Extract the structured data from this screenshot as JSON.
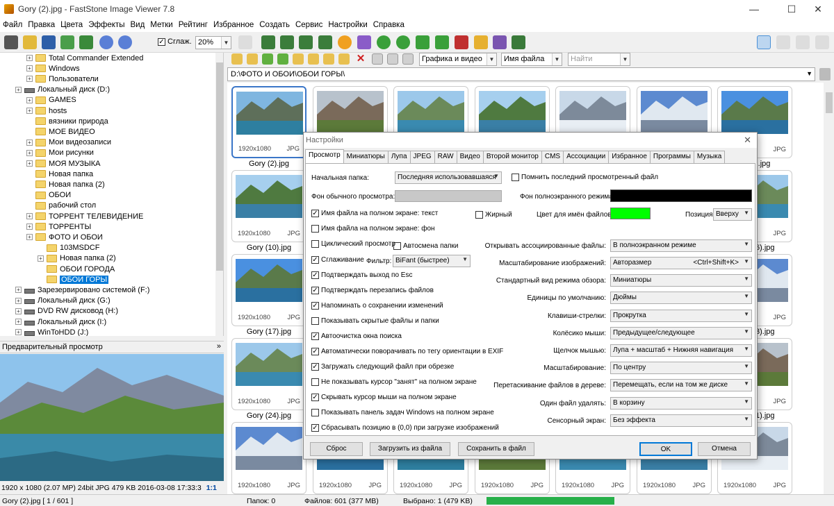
{
  "window": {
    "title": "Gory (2).jpg - FastStone Image Viewer 7.8",
    "min": "—",
    "max": "☐",
    "close": "✕"
  },
  "menu": [
    "Файл",
    "Правка",
    "Цвета",
    "Эффекты",
    "Вид",
    "Метки",
    "Рейтинг",
    "Избранное",
    "Создать",
    "Сервис",
    "Настройки",
    "Справка"
  ],
  "toolbar": {
    "smooth_label": "Сглаж.",
    "zoom": "20%"
  },
  "tree": [
    {
      "label": "Total Commander Extended",
      "level": 2,
      "type": "folder",
      "plus": true
    },
    {
      "label": "Windows",
      "level": 2,
      "type": "folder",
      "plus": true
    },
    {
      "label": "Пользователи",
      "level": 2,
      "type": "folder",
      "plus": true
    },
    {
      "label": "Локальный диск (D:)",
      "level": 1,
      "type": "drive",
      "plus": true
    },
    {
      "label": "GAMES",
      "level": 2,
      "type": "folder",
      "plus": true
    },
    {
      "label": "hosts",
      "level": 2,
      "type": "folder",
      "plus": true
    },
    {
      "label": "вязники природа",
      "level": 2,
      "type": "folder",
      "plus": false
    },
    {
      "label": "МОЕ ВИДЕО",
      "level": 2,
      "type": "folder",
      "plus": false
    },
    {
      "label": "Мои видеозаписи",
      "level": 2,
      "type": "folder",
      "plus": true
    },
    {
      "label": "Мои рисунки",
      "level": 2,
      "type": "folder",
      "plus": true
    },
    {
      "label": "МОЯ МУЗЫКА",
      "level": 2,
      "type": "folder",
      "plus": true
    },
    {
      "label": "Новая папка",
      "level": 2,
      "type": "folder",
      "plus": false
    },
    {
      "label": "Новая папка (2)",
      "level": 2,
      "type": "folder",
      "plus": false
    },
    {
      "label": "ОБОИ",
      "level": 2,
      "type": "folder",
      "plus": false
    },
    {
      "label": "рабочий стол",
      "level": 2,
      "type": "folder",
      "plus": false
    },
    {
      "label": "ТОРРЕНТ ТЕЛЕВИДЕНИЕ",
      "level": 2,
      "type": "folder",
      "plus": true
    },
    {
      "label": "ТОРРЕНТЫ",
      "level": 2,
      "type": "folder",
      "plus": true
    },
    {
      "label": "ФОТО И ОБОИ",
      "level": 2,
      "type": "folder",
      "plus": true
    },
    {
      "label": "103MSDCF",
      "level": 3,
      "type": "folder",
      "plus": false
    },
    {
      "label": "Новая папка (2)",
      "level": 3,
      "type": "folder",
      "plus": true
    },
    {
      "label": "ОБОИ ГОРОДА",
      "level": 3,
      "type": "folder",
      "plus": false
    },
    {
      "label": "ОБОИ ГОРЫ",
      "level": 3,
      "type": "folder",
      "plus": false,
      "selected": true
    },
    {
      "label": "Зарезервировано системой (F:)",
      "level": 1,
      "type": "drive",
      "plus": true
    },
    {
      "label": "Локальный диск (G:)",
      "level": 1,
      "type": "drive",
      "plus": true
    },
    {
      "label": "DVD RW дисковод (H:)",
      "level": 1,
      "type": "drive",
      "plus": true
    },
    {
      "label": "Локальный диск (I:)",
      "level": 1,
      "type": "drive",
      "plus": true
    },
    {
      "label": "WinToHDD (J:)",
      "level": 1,
      "type": "drive",
      "plus": true
    }
  ],
  "preview": {
    "header": "Предварительный просмотр",
    "info": "1920 x 1080 (2.07 MP)  24bit  JPG   479 KB   2016-03-08 17:33:3",
    "ratio": "1:1"
  },
  "nav": {
    "filter": "Графика и видео",
    "sort": "Имя файла",
    "search_placeholder": "Найти"
  },
  "address": "D:\\ФОТО И ОБОИ\\ОБОИ ГОРЫ\\",
  "thumb_res": "1920x1080",
  "thumb_ext": "JPG",
  "thumb_labels": [
    "Gory (2).jpg",
    "Gory (10).jpg",
    "Gory (17).jpg",
    "Gory (24).jpg"
  ],
  "thumb_labels_right": [
    ").jpg",
    "6).jpg",
    "3).jpg",
    "1).jpg"
  ],
  "status": {
    "file": "Gory (2).jpg [ 1 / 601 ]",
    "folders": "Папок: 0",
    "files": "Файлов: 601 (377 MB)",
    "selected": "Выбрано: 1 (479 KB)"
  },
  "dialog": {
    "title": "Настройки",
    "close": "✕",
    "tabs": [
      "Просмотр",
      "Миниатюры",
      "Лупа",
      "JPEG",
      "RAW",
      "Видео",
      "Второй монитор",
      "CMS",
      "Ассоциации",
      "Избранное",
      "Программы",
      "Музыка"
    ],
    "start_folder_label": "Начальная папка:",
    "start_folder_value": "Последняя использовавшаяся",
    "remember_last": "Помнить последний просмотренный файл",
    "bg_normal_label": "Фон обычного просмотра:",
    "bg_full_label": "Фон полноэкранного режима:",
    "filename_color_label": "Цвет для имён файлов:",
    "position_label": "Позиция:",
    "position_value": "Вверху",
    "bold_label": "Жирный",
    "filter_label": "Фильтр:",
    "filter_value": "BiFant (быстрее)",
    "left_checks": [
      {
        "label": "Имя файла на полном экране: текст",
        "checked": true
      },
      {
        "label": "Имя файла на полном экране: фон",
        "checked": false
      },
      {
        "label": "Циклический просмотр",
        "checked": false
      },
      {
        "label": "Сглаживание",
        "checked": true
      },
      {
        "label": "Подтверждать выход по Esc",
        "checked": true
      },
      {
        "label": "Подтверждать перезапись файлов",
        "checked": true
      },
      {
        "label": "Напоминать о сохранении изменений",
        "checked": true
      },
      {
        "label": "Показывать скрытые файлы и папки",
        "checked": false
      },
      {
        "label": "Автоочистка окна поиска",
        "checked": true
      },
      {
        "label": "Автоматически поворачивать по тегу ориентации в EXIF",
        "checked": true
      },
      {
        "label": "Загружать следующий файл при обрезке",
        "checked": true
      },
      {
        "label": "Не показывать курсор \"занят\" на полном экране",
        "checked": false
      },
      {
        "label": "Скрывать курсор мыши на полном экране",
        "checked": true
      },
      {
        "label": "Показывать панель задач Windows на полном экране",
        "checked": false
      },
      {
        "label": "Сбрасывать позицию в (0,0) при загрузке изображений",
        "checked": true
      }
    ],
    "autochange_label": "Автосмена папки",
    "right_rows": [
      {
        "label": "Открывать ассоциированные файлы:",
        "value": "В полноэкранном режиме"
      },
      {
        "label": "Масштабирование изображений:",
        "value": "Авторазмер",
        "extra": "<Ctrl+Shift+K>"
      },
      {
        "label": "Стандартный вид режима обзора:",
        "value": "Миниатюры"
      },
      {
        "label": "Единицы по умолчанию:",
        "value": "Дюймы"
      },
      {
        "label": "Клавиши-стрелки:",
        "value": "Прокрутка"
      },
      {
        "label": "Колёсико мыши:",
        "value": "Предыдущее/следующее"
      },
      {
        "label": "Щелчок мышью:",
        "value": "Лупа + масштаб + Нижняя навигация"
      },
      {
        "label": "Масштабирование:",
        "value": "По центру"
      },
      {
        "label": "Перетаскивание файлов в дереве:",
        "value": "Перемещать, если на том же диске"
      },
      {
        "label": "Один файл удалять:",
        "value": "В корзину"
      },
      {
        "label": "Сенсорный экран:",
        "value": "Без эффекта"
      }
    ],
    "buttons": {
      "reset": "Сброс",
      "load": "Загрузить из файла",
      "save": "Сохранить в файл",
      "ok": "OK",
      "cancel": "Отмена"
    },
    "colors": {
      "bg_normal": "#c8c8c8",
      "bg_full": "#000000",
      "name_color": "#00ff00"
    }
  },
  "check_mark": "✓",
  "colors": {
    "accent": "#0078d7",
    "progress": "#27b04a"
  }
}
